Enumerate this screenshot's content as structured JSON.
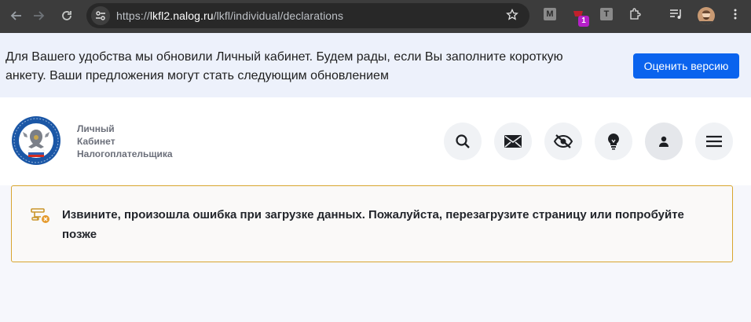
{
  "browser": {
    "url_prefix": "https://",
    "url_host": "lkfl2.nalog.ru",
    "url_path": "/lkfl/individual/declarations",
    "extensions": {
      "m_label": "M",
      "t_label": "T",
      "badge_count": "1"
    }
  },
  "banner": {
    "message": "Для Вашего удобства мы обновили Личный кабинет. Будем рады, если Вы заполните короткую анкету. Ваши предложения могут стать следующим обновлением",
    "button_label": "Оценить версию"
  },
  "header": {
    "logo_line1": "Личный",
    "logo_line2": "Кабинет",
    "logo_line3": "Налогоплательщика",
    "icons": [
      "search-icon",
      "mail-icon",
      "eye-off-icon",
      "lightbulb-icon",
      "user-icon",
      "menu-icon"
    ]
  },
  "error": {
    "message": "Извините, произошла ошибка при загрузке данных. Пожалуйста, перезагрузите страницу или попробуйте позже"
  },
  "colors": {
    "accent": "#0a63ee",
    "error_border": "#d8a52e",
    "error_icon": "#c9952a"
  }
}
